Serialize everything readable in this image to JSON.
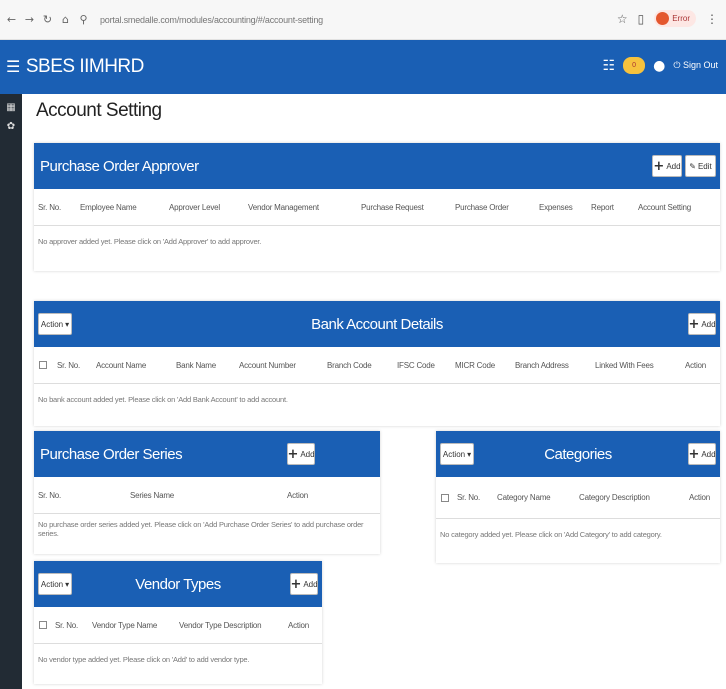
{
  "browser": {
    "url": "portal.smedalle.com/modules/accounting/#/account-setting",
    "profile_label": "Error"
  },
  "header": {
    "brand": "SBES IIMHRD",
    "notification_count": "0",
    "sign_out": "Sign Out"
  },
  "page": {
    "title": "Account Setting"
  },
  "purchase_order_approver": {
    "title": "Purchase Order Approver",
    "add_label": "Add",
    "edit_label": "Edit",
    "columns": [
      "Sr. No.",
      "Employee Name",
      "Approver Level",
      "Vendor Management",
      "Purchase Request",
      "Purchase Order",
      "Expenses",
      "Report",
      "Account Setting"
    ],
    "empty_text": "No approver added yet. Please click on 'Add Approver' to add approver."
  },
  "bank_account": {
    "title": "Bank Account Details",
    "action_label": "Action",
    "add_label": "Add",
    "columns": [
      "Sr. No.",
      "Account Name",
      "Bank Name",
      "Account Number",
      "Branch Code",
      "IFSC Code",
      "MICR Code",
      "Branch Address",
      "Linked With Fees",
      "Action"
    ],
    "empty_text": "No bank account added yet. Please click on 'Add Bank Account' to add account."
  },
  "po_series": {
    "title": "Purchase Order Series",
    "add_label": "Add",
    "columns": [
      "Sr. No.",
      "Series Name",
      "Action"
    ],
    "empty_text": "No purchase order series added yet. Please click on 'Add Purchase Order Series' to add purchase order series."
  },
  "categories": {
    "title": "Categories",
    "action_label": "Action",
    "add_label": "Add",
    "columns": [
      "Sr. No.",
      "Category Name",
      "Category Description",
      "Action"
    ],
    "empty_text": "No category added yet. Please click on 'Add Category' to add category."
  },
  "vendor_types": {
    "title": "Vendor Types",
    "action_label": "Action",
    "add_label": "Add",
    "columns": [
      "Sr. No.",
      "Vendor Type Name",
      "Vendor Type Description",
      "Action"
    ],
    "empty_text": "No vendor type added yet. Please click on 'Add' to add vendor type."
  },
  "colors": {
    "primary": "#1a5fb4",
    "sidebar": "#222b34"
  },
  "icons": [
    "back-arrow-icon",
    "forward-arrow-icon",
    "reload-icon",
    "home-icon",
    "site-info-icon",
    "star-icon",
    "extensions-icon",
    "kebab-menu-icon",
    "hamburger-menu-icon",
    "grid-icon",
    "bell-icon",
    "user-icon",
    "power-icon",
    "gear-icon",
    "plus-icon",
    "edit-icon",
    "caret-down-icon"
  ]
}
